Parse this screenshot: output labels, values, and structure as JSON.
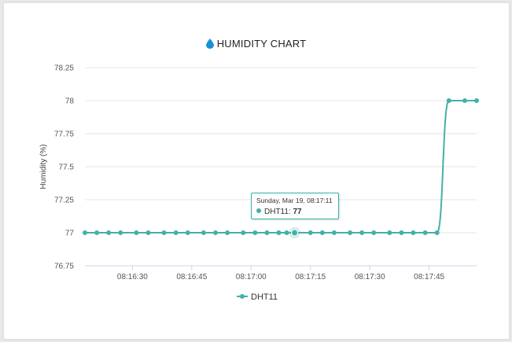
{
  "chart_data": {
    "type": "line",
    "title": "HUMIDITY CHART",
    "ylabel": "Humidity (%)",
    "xlabel": "",
    "ylim": [
      76.75,
      78.25
    ],
    "yticks": [
      "78.25",
      "78",
      "77.75",
      "77.5",
      "77.25",
      "77",
      "76.75"
    ],
    "xticks": [
      "08:16:30",
      "08:16:45",
      "08:17:00",
      "08:17:15",
      "08:17:30",
      "08:17:45"
    ],
    "grid": true,
    "legend_position": "bottom",
    "series": [
      {
        "name": "DHT11",
        "color": "#43b1a8",
        "x": [
          "08:16:18",
          "08:16:21",
          "08:16:24",
          "08:16:27",
          "08:16:31",
          "08:16:34",
          "08:16:38",
          "08:16:41",
          "08:16:44",
          "08:16:48",
          "08:16:51",
          "08:16:54",
          "08:16:58",
          "08:17:01",
          "08:17:04",
          "08:17:07",
          "08:17:09",
          "08:17:11",
          "08:17:15",
          "08:17:18",
          "08:17:21",
          "08:17:25",
          "08:17:28",
          "08:17:31",
          "08:17:35",
          "08:17:38",
          "08:17:41",
          "08:17:44",
          "08:17:47",
          "08:17:50",
          "08:17:54",
          "08:17:57"
        ],
        "values": [
          77,
          77,
          77,
          77,
          77,
          77,
          77,
          77,
          77,
          77,
          77,
          77,
          77,
          77,
          77,
          77,
          77,
          77,
          77,
          77,
          77,
          77,
          77,
          77,
          77,
          77,
          77,
          77,
          77,
          78,
          78,
          78
        ]
      }
    ]
  },
  "tooltip": {
    "date": "Sunday, Mar 19, 08:17:11",
    "series_label": "DHT11:",
    "value": "77"
  },
  "icons": {
    "title_icon": "water-drop-icon",
    "icon_color": "#1a8fd6"
  }
}
